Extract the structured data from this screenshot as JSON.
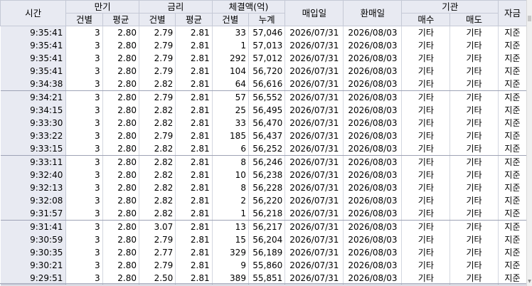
{
  "headers": {
    "time": "시간",
    "maturity": "만기",
    "rate": "금리",
    "volume": "체결액(억)",
    "buy_date": "매입일",
    "redeem_date": "환매일",
    "institution": "기관",
    "funding": "자금",
    "count": "건별",
    "avg": "평균",
    "rate_count": "건별",
    "rate_avg": "평균",
    "vol_count": "건별",
    "vol_cum": "누계",
    "inst_buy": "매수",
    "inst_sell": "매도"
  },
  "rows": [
    [
      "9:35:41",
      "3",
      "2.80",
      "2.79",
      "2.81",
      "33",
      "57,046",
      "2026/07/31",
      "2026/08/03",
      "기타",
      "기타",
      "지준"
    ],
    [
      "9:35:41",
      "3",
      "2.80",
      "2.79",
      "2.81",
      "1",
      "57,013",
      "2026/07/31",
      "2026/08/03",
      "기타",
      "기타",
      "지준"
    ],
    [
      "9:35:41",
      "3",
      "2.80",
      "2.79",
      "2.81",
      "292",
      "57,012",
      "2026/07/31",
      "2026/08/03",
      "기타",
      "기타",
      "지준"
    ],
    [
      "9:35:41",
      "3",
      "2.80",
      "2.79",
      "2.81",
      "104",
      "56,720",
      "2026/07/31",
      "2026/08/03",
      "기타",
      "기타",
      "지준"
    ],
    [
      "9:34:38",
      "3",
      "2.80",
      "2.82",
      "2.81",
      "64",
      "56,616",
      "2026/07/31",
      "2026/08/03",
      "기타",
      "기타",
      "지준"
    ],
    [
      "9:34:21",
      "3",
      "2.80",
      "2.79",
      "2.81",
      "57",
      "56,552",
      "2026/07/31",
      "2026/08/03",
      "기타",
      "기타",
      "지준"
    ],
    [
      "9:34:15",
      "3",
      "2.80",
      "2.82",
      "2.81",
      "25",
      "56,495",
      "2026/07/31",
      "2026/08/03",
      "기타",
      "기타",
      "지준"
    ],
    [
      "9:33:30",
      "3",
      "2.80",
      "2.82",
      "2.81",
      "33",
      "56,470",
      "2026/07/31",
      "2026/08/03",
      "기타",
      "기타",
      "지준"
    ],
    [
      "9:33:22",
      "3",
      "2.80",
      "2.79",
      "2.81",
      "185",
      "56,437",
      "2026/07/31",
      "2026/08/03",
      "기타",
      "기타",
      "지준"
    ],
    [
      "9:33:15",
      "3",
      "2.80",
      "2.82",
      "2.81",
      "6",
      "56,252",
      "2026/07/31",
      "2026/08/03",
      "기타",
      "기타",
      "지준"
    ],
    [
      "9:33:11",
      "3",
      "2.80",
      "2.82",
      "2.81",
      "8",
      "56,246",
      "2026/07/31",
      "2026/08/03",
      "기타",
      "기타",
      "지준"
    ],
    [
      "9:32:40",
      "3",
      "2.80",
      "2.82",
      "2.81",
      "10",
      "56,238",
      "2026/07/31",
      "2026/08/03",
      "기타",
      "기타",
      "지준"
    ],
    [
      "9:32:13",
      "3",
      "2.80",
      "2.82",
      "2.81",
      "8",
      "56,228",
      "2026/07/31",
      "2026/08/03",
      "기타",
      "기타",
      "지준"
    ],
    [
      "9:32:08",
      "3",
      "2.80",
      "2.82",
      "2.81",
      "2",
      "56,220",
      "2026/07/31",
      "2026/08/03",
      "기타",
      "기타",
      "지준"
    ],
    [
      "9:31:57",
      "3",
      "2.80",
      "2.82",
      "2.81",
      "1",
      "56,218",
      "2026/07/31",
      "2026/08/03",
      "기타",
      "기타",
      "지준"
    ],
    [
      "9:31:41",
      "3",
      "2.80",
      "3.07",
      "2.81",
      "13",
      "56,217",
      "2026/07/31",
      "2026/08/03",
      "기타",
      "기타",
      "지준"
    ],
    [
      "9:30:59",
      "3",
      "2.80",
      "2.79",
      "2.81",
      "15",
      "56,204",
      "2026/07/31",
      "2026/08/03",
      "기타",
      "기타",
      "지준"
    ],
    [
      "9:30:35",
      "3",
      "2.80",
      "2.77",
      "2.81",
      "329",
      "56,189",
      "2026/07/31",
      "2026/08/03",
      "기타",
      "기타",
      "지준"
    ],
    [
      "9:30:21",
      "3",
      "2.80",
      "2.79",
      "2.81",
      "9",
      "55,860",
      "2026/07/31",
      "2026/08/03",
      "기타",
      "기타",
      "지준"
    ],
    [
      "9:29:51",
      "3",
      "2.80",
      "2.50",
      "2.81",
      "389",
      "55,851",
      "2026/07/31",
      "2026/08/03",
      "기타",
      "기타",
      "지준"
    ]
  ]
}
